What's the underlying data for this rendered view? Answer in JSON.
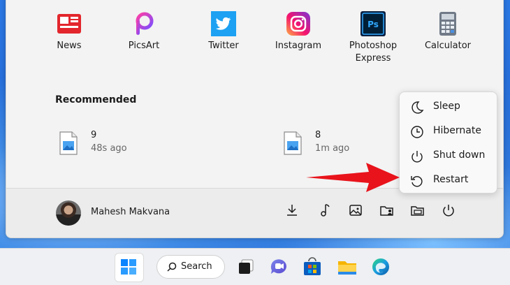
{
  "pinned": [
    {
      "label": "News",
      "icon": "news-icon"
    },
    {
      "label": "PicsArt",
      "icon": "picsart-icon"
    },
    {
      "label": "Twitter",
      "icon": "twitter-icon"
    },
    {
      "label": "Instagram",
      "icon": "instagram-icon"
    },
    {
      "label": "Photoshop Express",
      "line1": "Photoshop",
      "line2": "Express",
      "icon": "photoshop-icon"
    },
    {
      "label": "Calculator",
      "icon": "calculator-icon"
    }
  ],
  "recommended": {
    "title": "Recommended",
    "items": [
      {
        "name": "9",
        "time": "48s ago",
        "icon": "image-file-icon"
      },
      {
        "name": "8",
        "time": "1m ago",
        "icon": "image-file-icon"
      }
    ]
  },
  "user": {
    "name": "Mahesh Makvana"
  },
  "power_menu": [
    {
      "label": "Sleep",
      "icon": "moon-icon"
    },
    {
      "label": "Hibernate",
      "icon": "clock-icon"
    },
    {
      "label": "Shut down",
      "icon": "power-icon"
    },
    {
      "label": "Restart",
      "icon": "restart-icon"
    }
  ],
  "footer_icons": [
    "downloads-icon",
    "music-icon",
    "pictures-icon",
    "user-folder-icon",
    "file-explorer-icon",
    "power-icon"
  ],
  "taskbar": {
    "search_label": "Search"
  },
  "colors": {
    "arrow": "#e8131b",
    "accent": "#0067c0"
  }
}
